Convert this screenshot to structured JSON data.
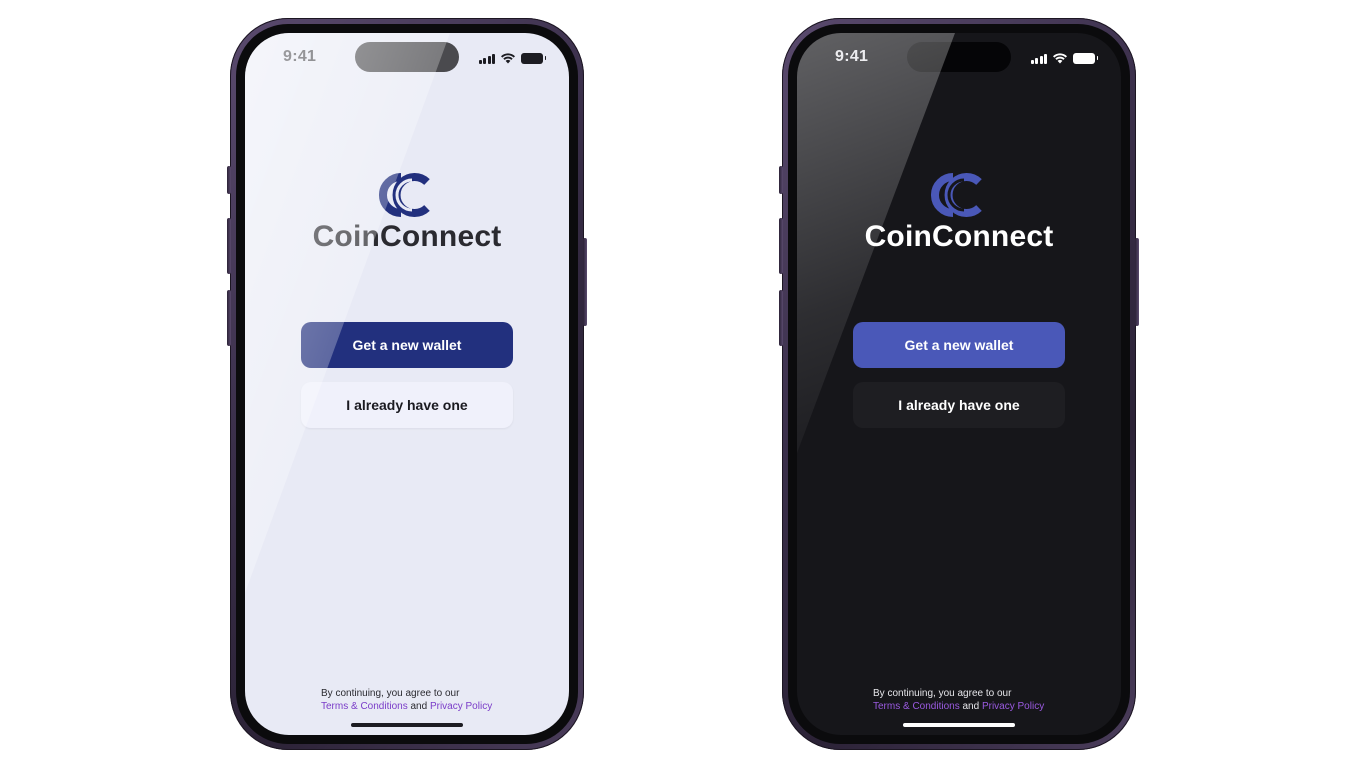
{
  "phones": [
    {
      "theme": "light",
      "status_bar": {
        "time": "9:41"
      },
      "brand": {
        "name": "CoinConnect",
        "logo_color": "#22307e"
      },
      "buttons": {
        "primary_label": "Get a new wallet",
        "secondary_label": "I already have one"
      },
      "legal": {
        "prefix": "By continuing, you agree to our",
        "terms_link": "Terms & Conditions",
        "conjunction": "and",
        "privacy_link": "Privacy Policy"
      }
    },
    {
      "theme": "dark",
      "status_bar": {
        "time": "9:41"
      },
      "brand": {
        "name": "CoinConnect",
        "logo_color": "#4a58b8"
      },
      "buttons": {
        "primary_label": "Get a new wallet",
        "secondary_label": "I already have one"
      },
      "legal": {
        "prefix": "By continuing, you agree to our",
        "terms_link": "Terms & Conditions",
        "conjunction": "and",
        "privacy_link": "Privacy Policy"
      }
    }
  ],
  "colors": {
    "light_primary_button": "#22307e",
    "dark_primary_button": "#4a58b8",
    "link": "#7a3cc8",
    "light_background": "#e8eaf5",
    "dark_background": "#16161a"
  },
  "icons": [
    "signal-icon",
    "wifi-icon",
    "battery-icon",
    "coinconnect-logo-icon"
  ]
}
